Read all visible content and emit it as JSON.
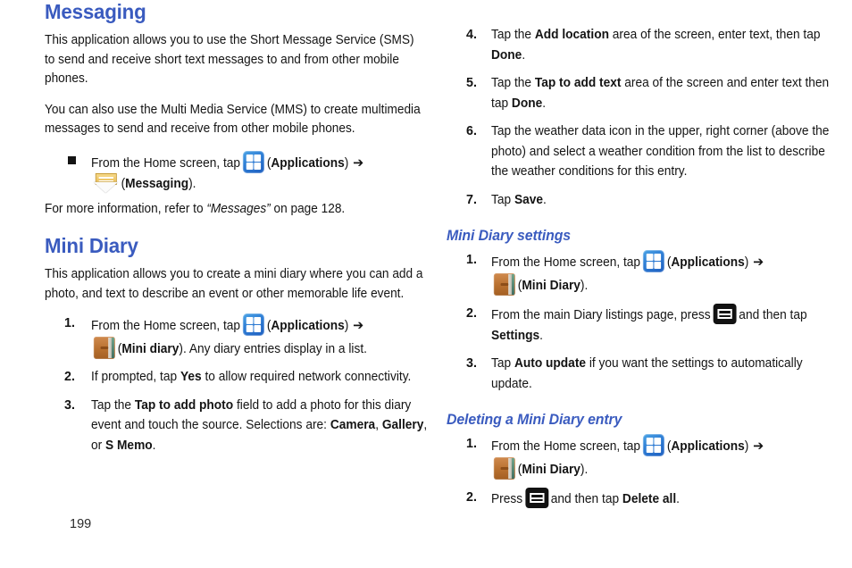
{
  "colors": {
    "heading_blue": "#3a5bbf",
    "body_black": "#141414",
    "apps_icon_blue": "#2f7fd6",
    "diary_icon_brown": "#b8702f",
    "messaging_icon_gold": "#e8b94e",
    "menu_icon_black": "#121212"
  },
  "page_number": "199",
  "left_column": {
    "heading": "Messaging",
    "paragraph_1": "This application allows you to use the Short Message Service (SMS) to send and receive short text messages to and from other mobile phones.",
    "paragraph_2": "You can also use the Multi Media Service (MMS) to create multimedia messages to send and receive from other mobile phones.",
    "bullet": {
      "marker": "square-bullet",
      "text_1": "From the Home screen, tap",
      "icon_1": "applications-icon",
      "label_1": "Applications",
      "label_1_open": "(",
      "label_1_close": ")",
      "arrow": "➔",
      "icon_2": "messaging-icon",
      "label_2": "Messaging",
      "label_2_open": "(",
      "label_2_close": ")."
    },
    "reference": {
      "prefix": "For more information, refer to",
      "quoted_title": "“Messages”",
      "suffix": "on page 128."
    },
    "heading_2": "Mini Diary",
    "paragraph_3": "This application allows you to create a mini diary where you can add a photo, and text to describe an event or other memorable life event.",
    "steps": [
      {
        "number": "1.",
        "text_1": "From the Home screen, tap",
        "icon_1": "applications-icon",
        "bold_1": "Applications",
        "arrow": "➔",
        "icon_2": "mini-diary-icon",
        "bold_2": "Mini diary",
        "text_2": ". Any diary entries display in a list."
      },
      {
        "number": "2.",
        "text_1": "If prompted, tap",
        "bold_1": "Yes",
        "text_2": "to allow required network connectivity."
      },
      {
        "number": "3.",
        "text_1": "Tap the",
        "bold_1": "Tap to add photo",
        "text_2": "field to add a photo for this diary event and touch the source. Selections are:",
        "bold_2": "Camera",
        "sep_1": ",",
        "bold_3": "Gallery",
        "sep_2": ", or",
        "bold_4": "S Memo",
        "sep_3": "."
      }
    ]
  },
  "right_column": {
    "steps_continued": [
      {
        "number": "4.",
        "text_1": "Tap the",
        "bold_1": "Add location",
        "text_2": "area of the screen, enter text, then tap",
        "bold_2": "Done",
        "text_3": "."
      },
      {
        "number": "5.",
        "text_1": "Tap the",
        "bold_1": "Tap to add text",
        "text_2": "area of the screen and enter text then tap",
        "bold_2": "Done",
        "text_3": "."
      },
      {
        "number": "6.",
        "text_1": "Tap the weather data icon in the upper, right corner (above the photo) and select a weather condition from the list to describe the weather conditions for this entry."
      },
      {
        "number": "7.",
        "text_1": "Tap",
        "bold_1": "Save",
        "text_3": "."
      }
    ],
    "subsection_1": {
      "heading": "Mini Diary settings",
      "steps": [
        {
          "number": "1.",
          "text_1": "From the Home screen, tap",
          "icon_1": "applications-icon",
          "bold_1": "Applications",
          "arrow": "➔",
          "icon_2": "mini-diary-icon",
          "bold_2": "Mini Diary",
          "text_2": ")."
        },
        {
          "number": "2.",
          "text_1": "From the main Diary listings page, press",
          "icon_1": "menu-key-icon",
          "text_2": "and then tap",
          "bold_1": "Settings",
          "text_3": "."
        },
        {
          "number": "3.",
          "text_1": "Tap",
          "bold_1": "Auto update",
          "text_2": "if you want the settings to automatically update."
        }
      ]
    },
    "subsection_2": {
      "heading": "Deleting a Mini Diary entry",
      "steps": [
        {
          "number": "1.",
          "text_1": "From the Home screen, tap",
          "icon_1": "applications-icon",
          "bold_1": "Applications",
          "arrow": "➔",
          "icon_2": "mini-diary-icon",
          "bold_2": "Mini Diary",
          "text_2": ")."
        },
        {
          "number": "2.",
          "text_1": "Press",
          "icon_1": "menu-key-icon",
          "text_2": "and then tap",
          "bold_1": "Delete all",
          "text_3": "."
        }
      ]
    }
  }
}
